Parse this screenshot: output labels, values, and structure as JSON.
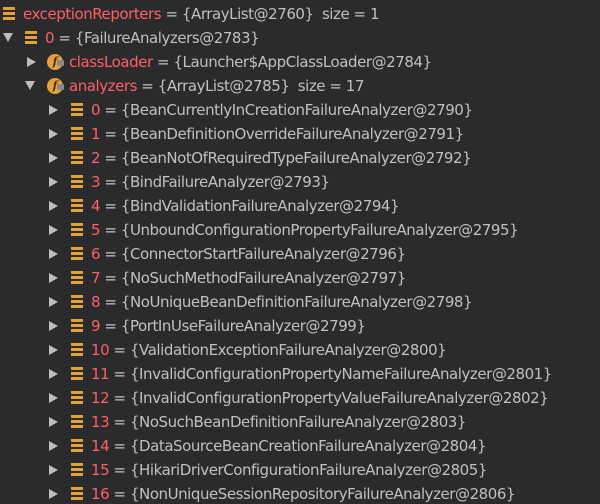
{
  "colors": {
    "background": "#2b2b2d",
    "name": "#ff5f66",
    "value": "#c0c0c0",
    "icon": "#e8a23a"
  },
  "root": {
    "name": "exceptionReporters",
    "separator": " = ",
    "value": "{ArrayList@2760}",
    "size": "size = 1"
  },
  "item0": {
    "name": "0",
    "separator": " = ",
    "value": "{FailureAnalyzers@2783}"
  },
  "classLoader": {
    "icon": "f",
    "name": "classLoader",
    "separator": " = ",
    "value": "{Launcher$AppClassLoader@2784}"
  },
  "analyzers": {
    "icon": "f",
    "name": "analyzers",
    "separator": " = ",
    "value": "{ArrayList@2785}",
    "size": "size = 17"
  },
  "items": [
    {
      "name": "0",
      "separator": " = ",
      "value": "{BeanCurrentlyInCreationFailureAnalyzer@2790}"
    },
    {
      "name": "1",
      "separator": " = ",
      "value": "{BeanDefinitionOverrideFailureAnalyzer@2791}"
    },
    {
      "name": "2",
      "separator": " = ",
      "value": "{BeanNotOfRequiredTypeFailureAnalyzer@2792}"
    },
    {
      "name": "3",
      "separator": " = ",
      "value": "{BindFailureAnalyzer@2793}"
    },
    {
      "name": "4",
      "separator": " = ",
      "value": "{BindValidationFailureAnalyzer@2794}"
    },
    {
      "name": "5",
      "separator": " = ",
      "value": "{UnboundConfigurationPropertyFailureAnalyzer@2795}"
    },
    {
      "name": "6",
      "separator": " = ",
      "value": "{ConnectorStartFailureAnalyzer@2796}"
    },
    {
      "name": "7",
      "separator": " = ",
      "value": "{NoSuchMethodFailureAnalyzer@2797}"
    },
    {
      "name": "8",
      "separator": " = ",
      "value": "{NoUniqueBeanDefinitionFailureAnalyzer@2798}"
    },
    {
      "name": "9",
      "separator": " = ",
      "value": "{PortInUseFailureAnalyzer@2799}"
    },
    {
      "name": "10",
      "separator": " = ",
      "value": "{ValidationExceptionFailureAnalyzer@2800}"
    },
    {
      "name": "11",
      "separator": " = ",
      "value": "{InvalidConfigurationPropertyNameFailureAnalyzer@2801}"
    },
    {
      "name": "12",
      "separator": " = ",
      "value": "{InvalidConfigurationPropertyValueFailureAnalyzer@2802}"
    },
    {
      "name": "13",
      "separator": " = ",
      "value": "{NoSuchBeanDefinitionFailureAnalyzer@2803}"
    },
    {
      "name": "14",
      "separator": " = ",
      "value": "{DataSourceBeanCreationFailureAnalyzer@2804}"
    },
    {
      "name": "15",
      "separator": " = ",
      "value": "{HikariDriverConfigurationFailureAnalyzer@2805}"
    },
    {
      "name": "16",
      "separator": " = ",
      "value": "{NonUniqueSessionRepositoryFailureAnalyzer@2806}"
    }
  ]
}
